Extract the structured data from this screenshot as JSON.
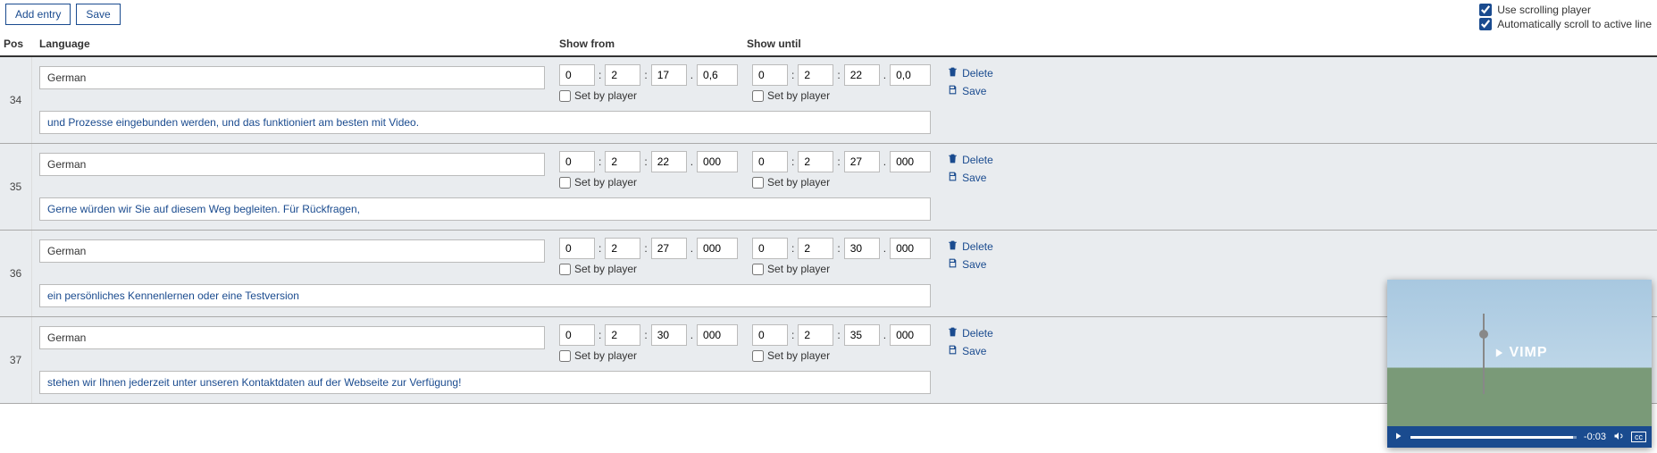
{
  "toolbar": {
    "add_entry": "Add entry",
    "save": "Save"
  },
  "options": {
    "use_scrolling_player": "Use scrolling player",
    "auto_scroll": "Automatically scroll to active line"
  },
  "headers": {
    "pos": "Pos",
    "language": "Language",
    "show_from": "Show from",
    "show_until": "Show until"
  },
  "labels": {
    "set_by_player": "Set by player",
    "delete": "Delete",
    "save_entry": "Save"
  },
  "entries": [
    {
      "pos": "34",
      "language": "German",
      "from": {
        "h": "0",
        "m": "2",
        "s": "17",
        "ms": "0,6"
      },
      "until": {
        "h": "0",
        "m": "2",
        "s": "22",
        "ms": "0,0"
      },
      "text": "und Prozesse eingebunden werden, und das funktioniert am besten mit Video."
    },
    {
      "pos": "35",
      "language": "German",
      "from": {
        "h": "0",
        "m": "2",
        "s": "22",
        "ms": "000"
      },
      "until": {
        "h": "0",
        "m": "2",
        "s": "27",
        "ms": "000"
      },
      "text": "Gerne würden wir Sie auf diesem Weg begleiten. Für Rückfragen,"
    },
    {
      "pos": "36",
      "language": "German",
      "from": {
        "h": "0",
        "m": "2",
        "s": "27",
        "ms": "000"
      },
      "until": {
        "h": "0",
        "m": "2",
        "s": "30",
        "ms": "000"
      },
      "text": "ein persönliches Kennenlernen oder eine Testversion"
    },
    {
      "pos": "37",
      "language": "German",
      "from": {
        "h": "0",
        "m": "2",
        "s": "30",
        "ms": "000"
      },
      "until": {
        "h": "0",
        "m": "2",
        "s": "35",
        "ms": "000"
      },
      "text": "stehen wir Ihnen jederzeit unter unseren Kontaktdaten auf der Webseite zur Verfügung!"
    }
  ],
  "player": {
    "logo": "VIMP",
    "time": "-0:03",
    "cc": "cc"
  }
}
